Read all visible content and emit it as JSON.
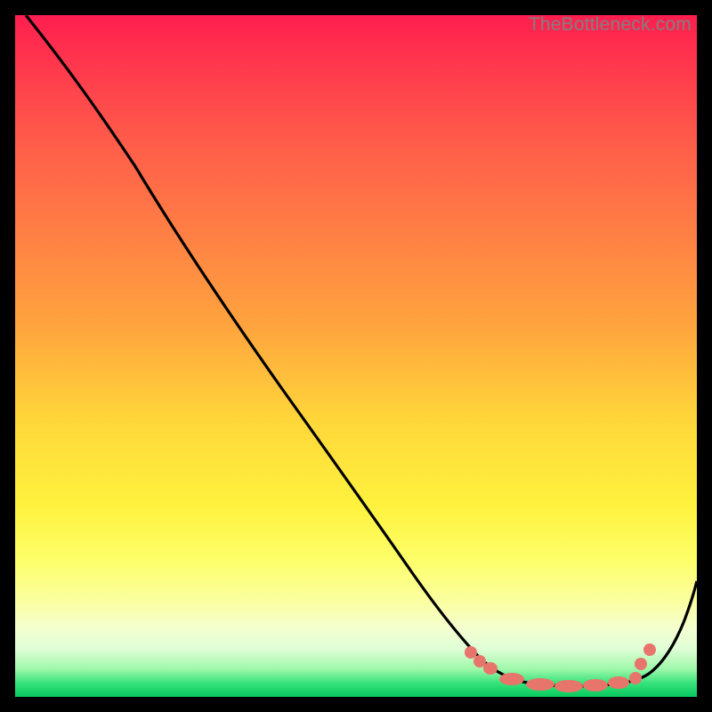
{
  "watermark": "TheBottleneck.com",
  "colors": {
    "gradient_top": "#ff1e4f",
    "gradient_mid": "#ffd83a",
    "gradient_bottom": "#08c95f",
    "curve_stroke": "#000000",
    "dot_fill": "#e8756b",
    "dot_stroke": "#d85a52",
    "frame_bg": "#000000"
  },
  "chart_data": {
    "type": "line",
    "title": "",
    "xlabel": "",
    "ylabel": "",
    "xlim": [
      0,
      100
    ],
    "ylim": [
      0,
      100
    ],
    "grid": false,
    "legend": false,
    "series": [
      {
        "name": "bottleneck-curve",
        "x": [
          0,
          3,
          7,
          12,
          18,
          25,
          32,
          40,
          48,
          55,
          60,
          64,
          67,
          69,
          72,
          75,
          78,
          80,
          83,
          86,
          88,
          91,
          94,
          97,
          100
        ],
        "y": [
          100,
          98,
          95,
          91,
          85,
          77,
          68,
          57,
          46,
          36,
          28,
          21,
          15,
          11,
          7,
          4,
          2,
          1,
          0.6,
          0.8,
          2,
          6,
          12,
          20,
          29
        ],
        "note": "y is bottleneck percentage (approx. read from gradient height); curve dips to ~0 near x≈82 then rises."
      }
    ],
    "highlight_dots": {
      "name": "flat-region-markers",
      "x": [
        66,
        68,
        70,
        73,
        76,
        79,
        82,
        85,
        88,
        89,
        91
      ],
      "y": [
        9,
        6,
        4,
        2,
        1,
        0.7,
        0.5,
        0.7,
        2,
        5,
        9
      ],
      "note": "salmon dots clustered around the trough of the curve"
    }
  }
}
